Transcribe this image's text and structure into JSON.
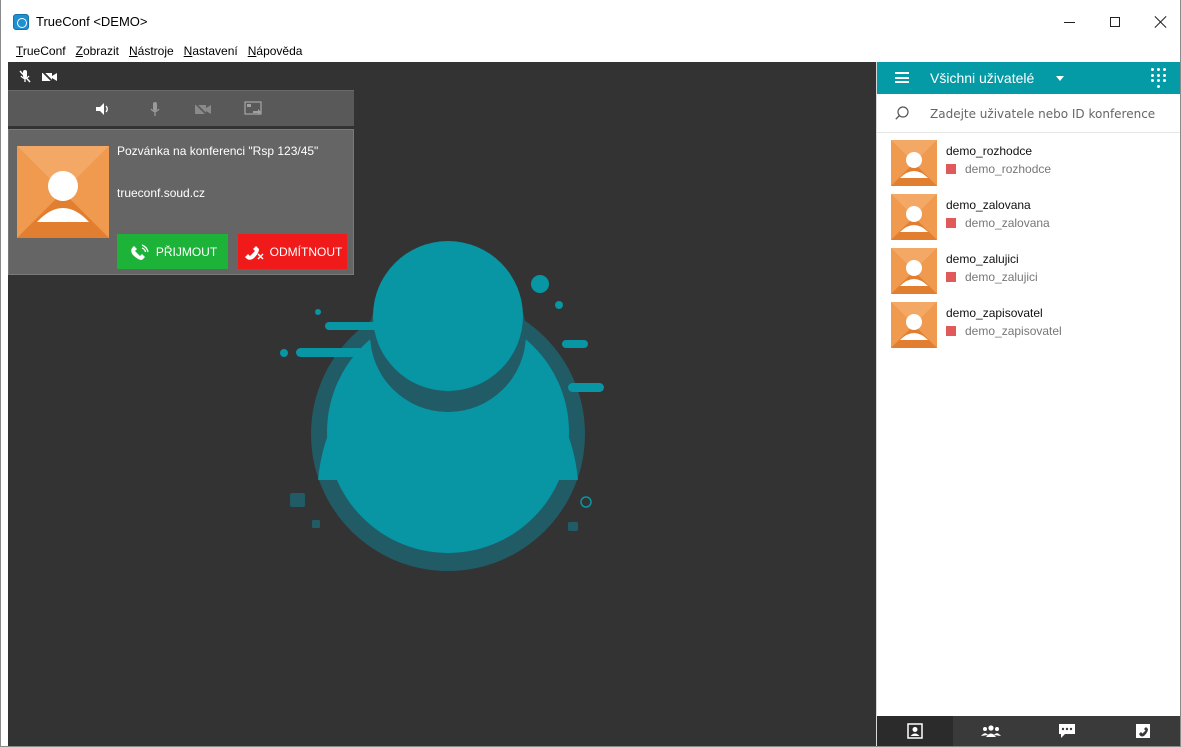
{
  "window": {
    "title": "TrueConf <DEMO>"
  },
  "menubar": {
    "items": [
      "TrueConf",
      "Zobrazit",
      "Nástroje",
      "Nastavení",
      "Nápověda"
    ]
  },
  "incoming_call": {
    "title": "Pozvánka na konferenci \"Rsp 123/45\"",
    "host": "trueconf.soud.cz",
    "accept_label": "PŘIJMOUT",
    "decline_label": "ODMÍTNOUT"
  },
  "sidebar": {
    "title": "Všichni uživatelé",
    "search_placeholder": "Zadejte uživatele nebo ID konference",
    "contacts": [
      {
        "name": "demo_rozhodce",
        "login": "demo_rozhodce"
      },
      {
        "name": "demo_zalovana",
        "login": "demo_zalovana"
      },
      {
        "name": "demo_zalujici",
        "login": "demo_zalujici"
      },
      {
        "name": "demo_zapisovatel",
        "login": "demo_zapisovatel"
      }
    ]
  },
  "colors": {
    "accent": "#049aa6",
    "accept": "#1db339",
    "decline": "#f11a1a",
    "avatar": "#ea8a3c",
    "status_offline": "#e15a5a",
    "video_bg": "#333333"
  },
  "icons": {
    "status": [
      "mic-muted-icon",
      "camera-off-icon"
    ],
    "toolbar": [
      "speaker-icon",
      "microphone-icon",
      "camera-icon",
      "screen-share-icon"
    ],
    "tabs": [
      "contacts-tab-icon",
      "conferences-tab-icon",
      "chat-tab-icon",
      "call-history-tab-icon"
    ]
  }
}
